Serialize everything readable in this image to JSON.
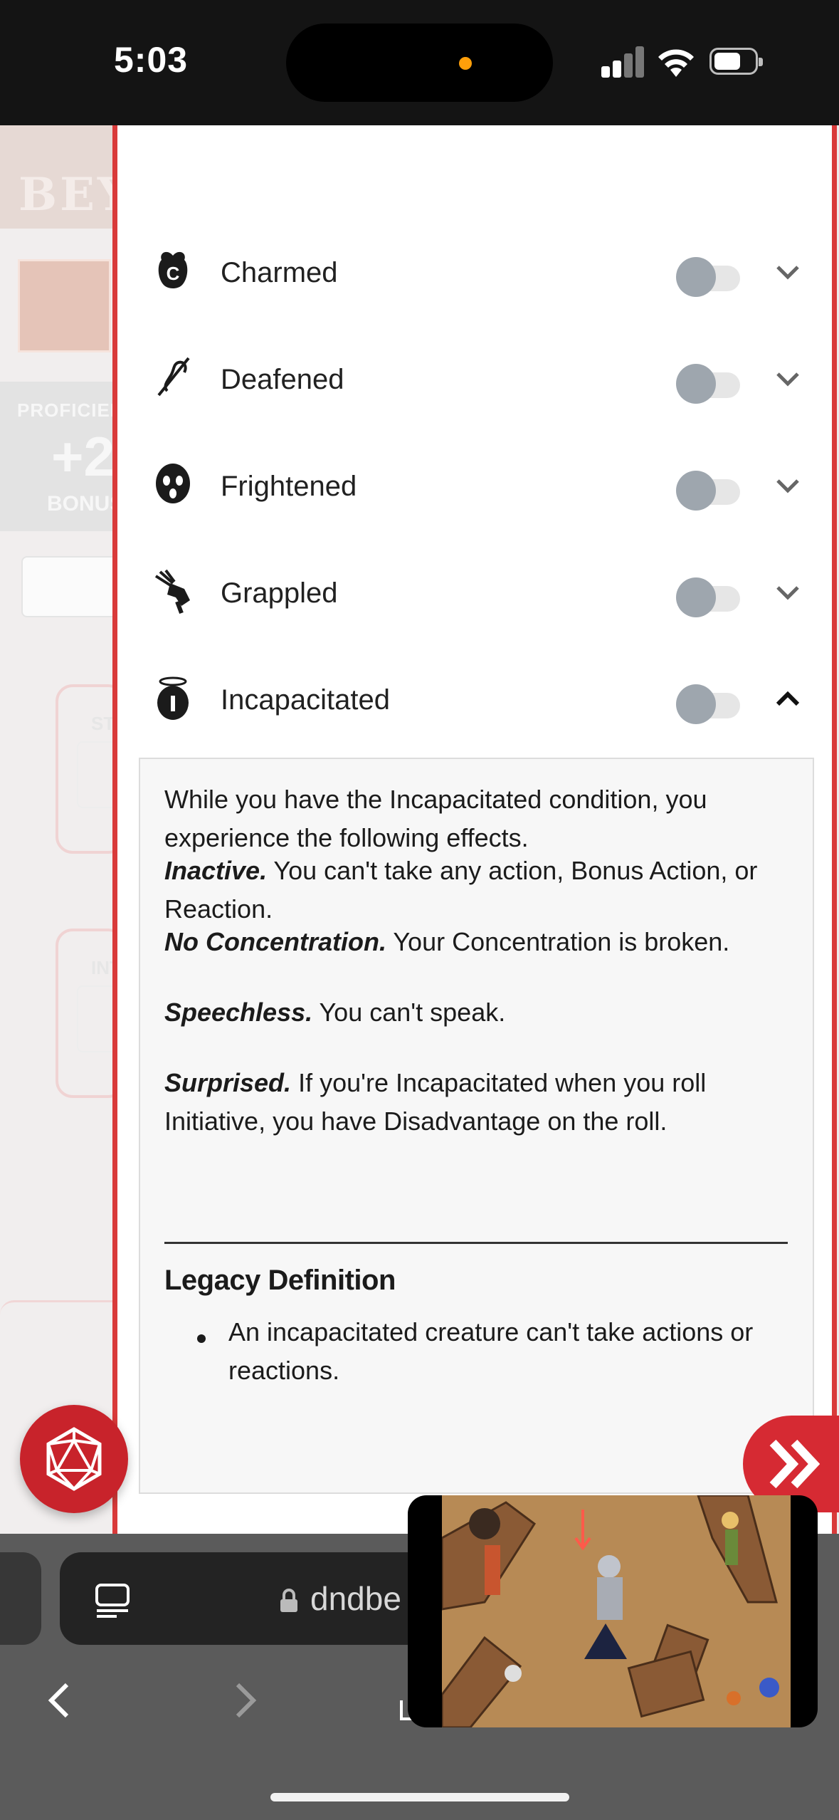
{
  "status_bar": {
    "time": "5:03"
  },
  "background_page": {
    "logo_text": "BEY",
    "proficiency_label": "PROFICIEN",
    "proficiency_value": "+2",
    "proficiency_bonus_label": "BONUS",
    "stat1_label": "ST",
    "stat2_label": "INT"
  },
  "conditions": [
    {
      "name": "Charmed",
      "icon": "charmed-icon",
      "expanded": false
    },
    {
      "name": "Deafened",
      "icon": "deafened-icon",
      "expanded": false
    },
    {
      "name": "Frightened",
      "icon": "frightened-icon",
      "expanded": false
    },
    {
      "name": "Grappled",
      "icon": "grappled-icon",
      "expanded": false
    },
    {
      "name": "Incapacitated",
      "icon": "incapacitated-icon",
      "expanded": true
    }
  ],
  "incapacitated": {
    "intro": "While you have the Incapacitated condition, you experience the following effects.",
    "effects": [
      {
        "title": "Inactive.",
        "text": " You can't take any action, Bonus Action, or Reaction."
      },
      {
        "title": "No Concentration.",
        "text": " Your Concentration is broken."
      },
      {
        "title": "Speechless.",
        "text": " You can't speak."
      },
      {
        "title": "Surprised.",
        "text": " If you're Incapacitated when you roll Initiative, you have Disadvantage on the roll."
      }
    ],
    "legacy_title": "Legacy Definition",
    "legacy_items": [
      "An incapacitated creature can't take actions or reactions."
    ]
  },
  "browser": {
    "url": "dndbe"
  },
  "colors": {
    "accent_red": "#d93a3a",
    "toggle_knob": "#9ea6ae"
  }
}
